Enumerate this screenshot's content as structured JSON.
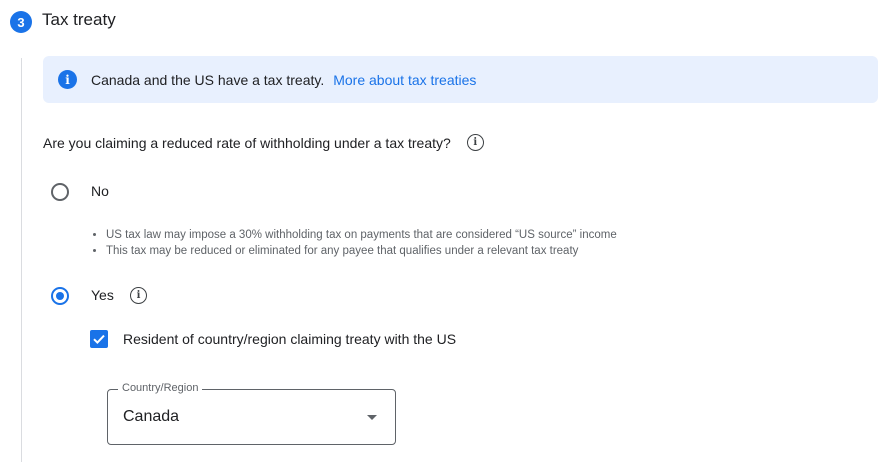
{
  "step": {
    "number": "3",
    "title": "Tax treaty"
  },
  "banner": {
    "text": "Canada and the US have a tax treaty.",
    "link": "More about tax treaties"
  },
  "question": "Are you claiming a reduced rate of withholding under a tax treaty?",
  "options": {
    "no": {
      "label": "No",
      "selected": false
    },
    "yes": {
      "label": "Yes",
      "selected": true
    }
  },
  "no_notes": [
    "US tax law may impose a 30% withholding tax on payments that are considered “US source” income",
    "This tax may be reduced or eliminated for any payee that qualifies under a relevant tax treaty"
  ],
  "resident_checkbox": {
    "label": "Resident of country/region claiming treaty with the US",
    "checked": true
  },
  "country_select": {
    "label": "Country/Region",
    "value": "Canada"
  },
  "colors": {
    "accent": "#1a73e8",
    "banner_bg": "#e8f0fe"
  },
  "icons": [
    "step-number-badge",
    "info-icon",
    "info-outline-icon",
    "check-icon",
    "dropdown-arrow-icon"
  ]
}
